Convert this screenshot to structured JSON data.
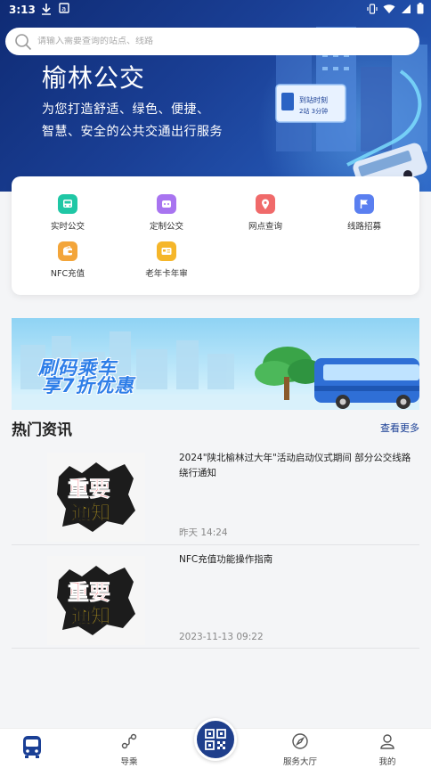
{
  "status_bar": {
    "time": "3:13"
  },
  "search": {
    "placeholder": "请输入需要查询的站点、线路"
  },
  "hero": {
    "title": "榆林公交",
    "subtitle_line1": "为您打造舒适、绿色、便捷、",
    "subtitle_line2": "智慧、安全的公共交通出行服务",
    "sign_text": "榆林公交"
  },
  "services": [
    {
      "label": "实时公交",
      "icon": "bus-icon",
      "color": "#1fc7a5"
    },
    {
      "label": "定制公交",
      "icon": "custom-bus-icon",
      "color": "#a874f0"
    },
    {
      "label": "网点查询",
      "icon": "location-icon",
      "color": "#f06a6a"
    },
    {
      "label": "线路招募",
      "icon": "flag-icon",
      "color": "#5a7ff0"
    },
    {
      "label": "NFC充值",
      "icon": "wallet-icon",
      "color": "#f3a53a"
    },
    {
      "label": "老年卡年审",
      "icon": "card-icon",
      "color": "#f5b62a"
    }
  ],
  "banner": {
    "line1": "刷码乘车",
    "line2": "享7折优惠"
  },
  "news": {
    "title": "热门资讯",
    "more": "查看更多",
    "items": [
      {
        "title": "2024\"陕北榆林过大年\"活动启动仪式期间 部分公交线路绕行通知",
        "date": "昨天  14:24",
        "thumb_text_top": "重要",
        "thumb_text_bottom": "通知"
      },
      {
        "title": "NFC充值功能操作指南",
        "date": "2023-11-13 09:22",
        "thumb_text_top": "重要",
        "thumb_text_bottom": "通知"
      }
    ]
  },
  "nav": {
    "home": "",
    "guide": "导乘",
    "service_hall": "服务大厅",
    "mine": "我的"
  },
  "colors": {
    "primary": "#1a3f95",
    "accent_blue": "#2e7ee8"
  }
}
